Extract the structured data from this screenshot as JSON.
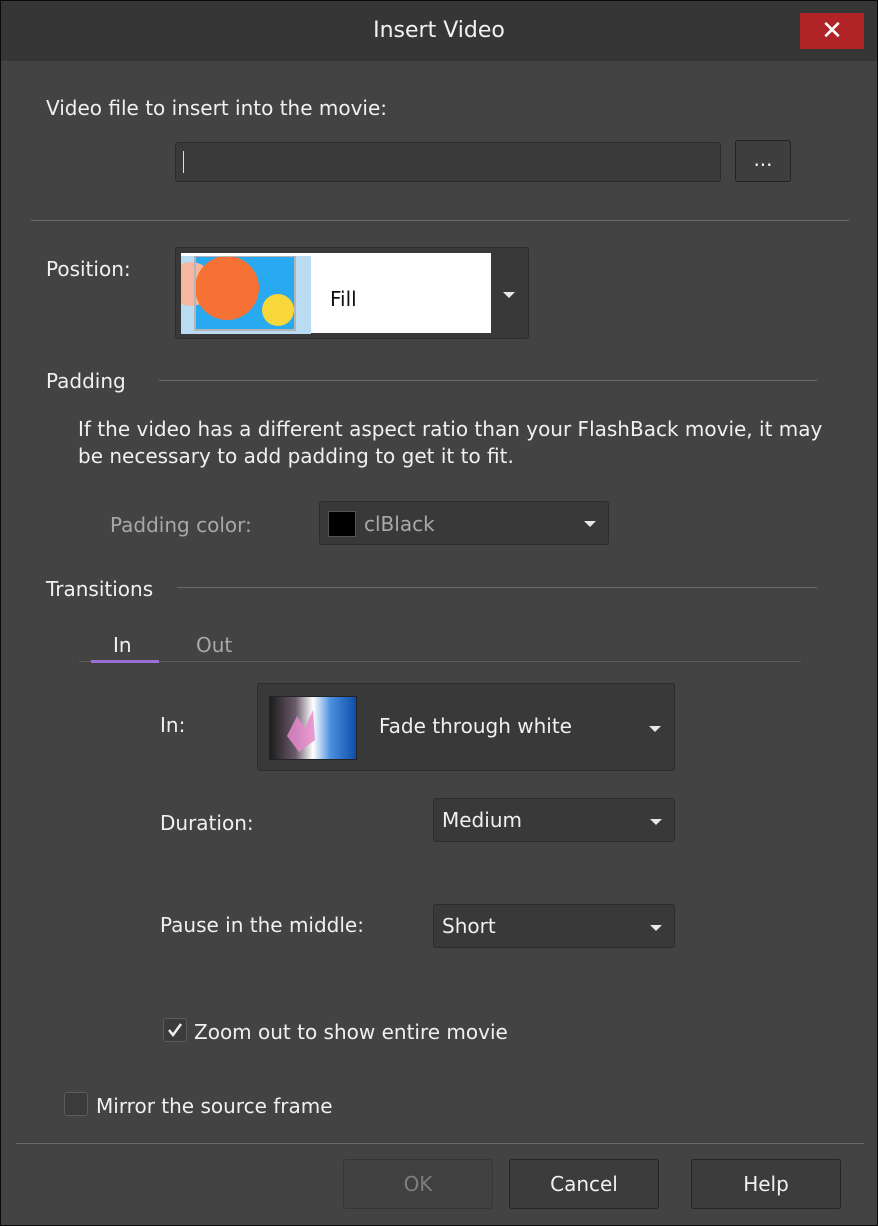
{
  "dialog": {
    "title": "Insert Video",
    "close_glyph": "✕"
  },
  "video_file": {
    "label": "Video file to insert into the movie:",
    "value": "",
    "browse_label": "..."
  },
  "position": {
    "label": "Position:",
    "value": "Fill"
  },
  "padding": {
    "heading": "Padding",
    "description_line1": "If the video has a different aspect ratio than your FlashBack movie, it may",
    "description_line2": "be necessary to add padding to get it to fit.",
    "color_label": "Padding color:",
    "color_value": "clBlack",
    "color_swatch": "#000000"
  },
  "transitions": {
    "heading": "Transitions",
    "tabs": [
      {
        "label": "In",
        "selected": true
      },
      {
        "label": "Out",
        "selected": false
      }
    ],
    "in_label": "In:",
    "in_value": "Fade through white",
    "duration_label": "Duration:",
    "duration_value": "Medium",
    "pause_label": "Pause in the middle:",
    "pause_value": "Short",
    "zoom_label": "Zoom out to show entire movie",
    "zoom_checked": true
  },
  "mirror": {
    "label": "Mirror the source frame",
    "checked": false
  },
  "buttons": {
    "ok": "OK",
    "cancel": "Cancel",
    "help": "Help"
  },
  "colors": {
    "accent_tab": "#9a6fd6",
    "close_red": "#b02327",
    "background": "#434343"
  }
}
